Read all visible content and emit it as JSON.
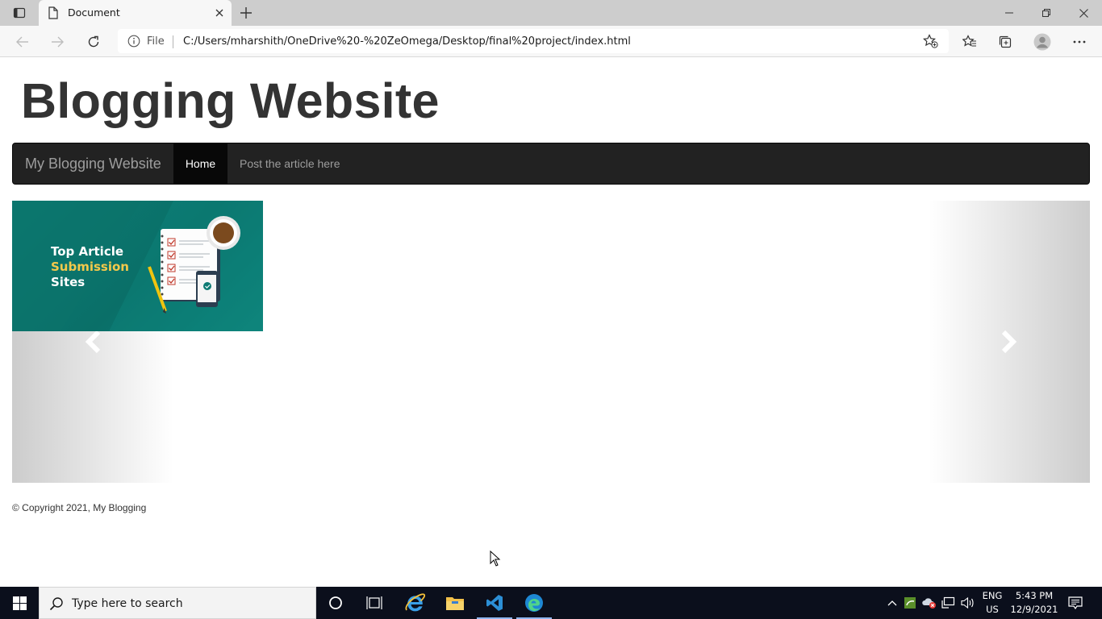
{
  "browser": {
    "tab_title": "Document",
    "scheme_label": "File",
    "url": "C:/Users/mharshith/OneDrive%20-%20ZeOmega/Desktop/final%20project/index.html"
  },
  "page": {
    "title": "Blogging Website",
    "navbar": {
      "brand": "My Blogging Website",
      "items": [
        {
          "label": "Home",
          "active": true
        },
        {
          "label": "Post the article here",
          "active": false
        }
      ]
    },
    "carousel": {
      "slide_text_line1": "Top Article",
      "slide_text_line2": "Submission",
      "slide_text_line3": "Sites",
      "prev_icon": "chevron-left-icon",
      "next_icon": "chevron-right-icon"
    },
    "footer": "© Copyright 2021, My Blogging"
  },
  "taskbar": {
    "search_placeholder": "Type here to search",
    "language_line1": "ENG",
    "language_line2": "US",
    "time": "5:43 PM",
    "date": "12/9/2021"
  },
  "colors": {
    "navbar_bg": "#222222",
    "navbar_active_bg": "#080808",
    "slide_teal": "#0c7c73",
    "slide_yellow": "#f4c94b",
    "taskbar_bg": "#0b0f1c"
  }
}
